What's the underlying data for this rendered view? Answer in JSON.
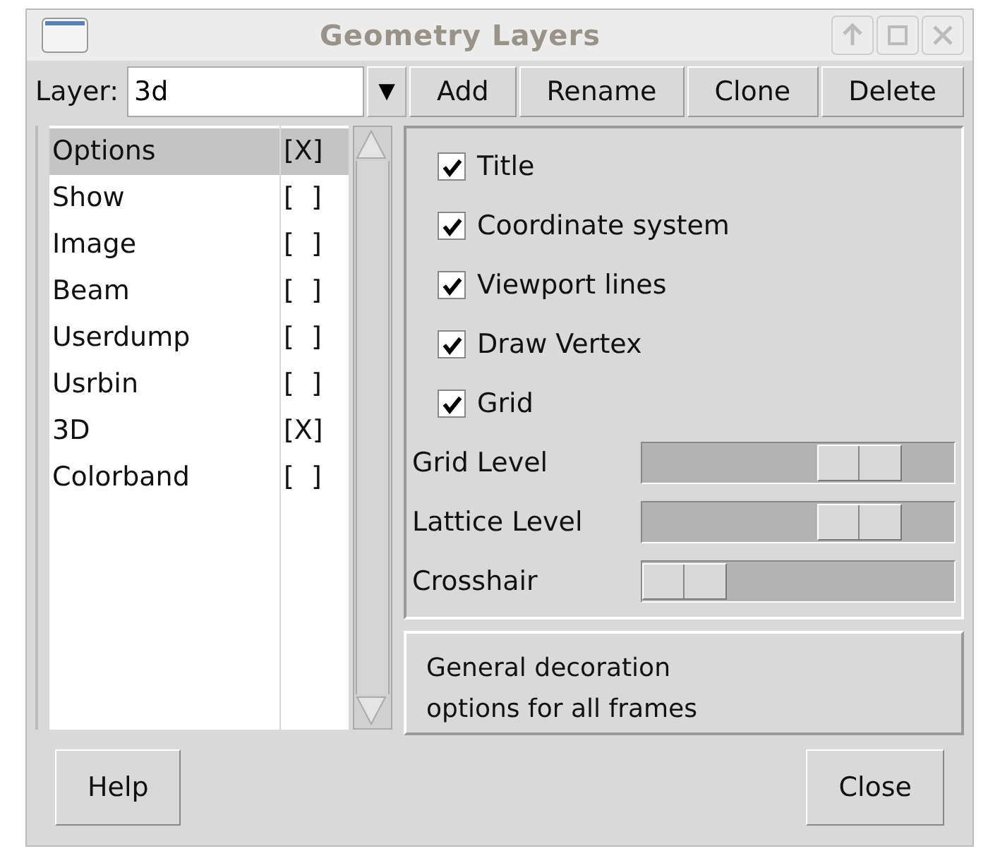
{
  "window": {
    "title": "Geometry Layers"
  },
  "layer": {
    "label": "Layer:",
    "value": "3d",
    "dropdown": "▼"
  },
  "layer_buttons": [
    "Add",
    "Rename",
    "Clone",
    "Delete"
  ],
  "layers": [
    {
      "name": "Options",
      "flag": "[X]",
      "selected": true
    },
    {
      "name": "Show",
      "flag": "[  ]",
      "selected": false
    },
    {
      "name": "Image",
      "flag": "[  ]",
      "selected": false
    },
    {
      "name": "Beam",
      "flag": "[  ]",
      "selected": false
    },
    {
      "name": "Userdump",
      "flag": "[  ]",
      "selected": false
    },
    {
      "name": "Usrbin",
      "flag": "[  ]",
      "selected": false
    },
    {
      "name": "3D",
      "flag": "[X]",
      "selected": false
    },
    {
      "name": "Colorband",
      "flag": "[  ]",
      "selected": false
    }
  ],
  "options": [
    {
      "kind": "checkbox",
      "label": "Title",
      "checked": true
    },
    {
      "kind": "checkbox",
      "label": "Coordinate system",
      "checked": true
    },
    {
      "kind": "checkbox",
      "label": "Viewport lines",
      "checked": true
    },
    {
      "kind": "checkbox",
      "label": "Draw Vertex",
      "checked": true
    },
    {
      "kind": "checkbox",
      "label": "Grid",
      "checked": true
    },
    {
      "kind": "slider",
      "label": "Grid Level",
      "level": 0.77
    },
    {
      "kind": "slider",
      "label": "Lattice Level",
      "level": 0.77
    },
    {
      "kind": "slider",
      "label": "Crosshair",
      "level": 0
    }
  ],
  "description": "General decoration\noptions for all frames",
  "buttons": [
    "Help",
    "Close"
  ]
}
